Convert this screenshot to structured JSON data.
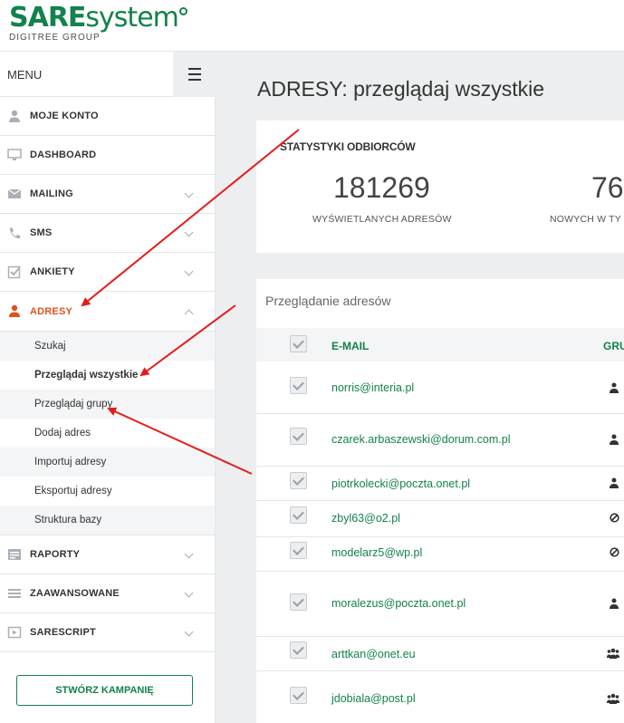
{
  "brand": {
    "logo_sare": "SARE",
    "logo_system": "system",
    "logo_sub": "DIGITREE GROUP"
  },
  "sidebar": {
    "menu_label": "MENU",
    "items": [
      {
        "label": "MOJE KONTO",
        "icon": "user-icon"
      },
      {
        "label": "DASHBOARD",
        "icon": "monitor-icon"
      },
      {
        "label": "MAILING",
        "icon": "envelope-icon"
      },
      {
        "label": "SMS",
        "icon": "phone-icon"
      },
      {
        "label": "ANKIETY",
        "icon": "checkbox-icon"
      },
      {
        "label": "ADRESY",
        "icon": "user-icon"
      },
      {
        "label": "RAPORTY",
        "icon": "report-icon"
      },
      {
        "label": "ZAAWANSOWANE",
        "icon": "bars-icon"
      },
      {
        "label": "SARESCRIPT",
        "icon": "play-icon"
      }
    ],
    "subitems": [
      {
        "label": "Szukaj"
      },
      {
        "label": "Przeglądaj wszystkie"
      },
      {
        "label": "Przeglądaj grupy"
      },
      {
        "label": "Dodaj adres"
      },
      {
        "label": "Importuj adresy"
      },
      {
        "label": "Eksportuj adresy"
      },
      {
        "label": "Struktura bazy"
      }
    ],
    "create_button": "STWÓRZ KAMPANIĘ"
  },
  "main": {
    "title": "ADRESY: przeglądaj wszystkie",
    "stats": {
      "title": "STATYSTYKI ODBIORCÓW",
      "items": [
        {
          "value": "181269",
          "caption": "WYŚWIETLANYCH ADRESÓW"
        },
        {
          "value": "76",
          "caption": "NOWYCH W TY"
        }
      ]
    },
    "list": {
      "title": "Przeglądanie adresów",
      "columns": {
        "email": "E-MAIL",
        "group": "GRU"
      },
      "rows": [
        {
          "email": "norris@interia.pl",
          "group_icon": "user-icon"
        },
        {
          "email": "czarek.arbaszewski@dorum.com.pl",
          "group_icon": "user-icon"
        },
        {
          "email": "piotrkolecki@poczta.onet.pl",
          "group_icon": "user-icon"
        },
        {
          "email": "zbyl63@o2.pl",
          "group_icon": "ban-icon"
        },
        {
          "email": "modelarz5@wp.pl",
          "group_icon": "ban-icon"
        },
        {
          "email": "moralezus@poczta.onet.pl",
          "group_icon": "user-icon"
        },
        {
          "email": "arttkan@onet.eu",
          "group_icon": "users-icon"
        },
        {
          "email": "jdobiala@post.pl",
          "group_icon": "users-icon"
        }
      ]
    }
  },
  "colors": {
    "brand_green": "#13824c",
    "active_orange": "#e0511e",
    "arrow_red": "#e51b1b"
  }
}
